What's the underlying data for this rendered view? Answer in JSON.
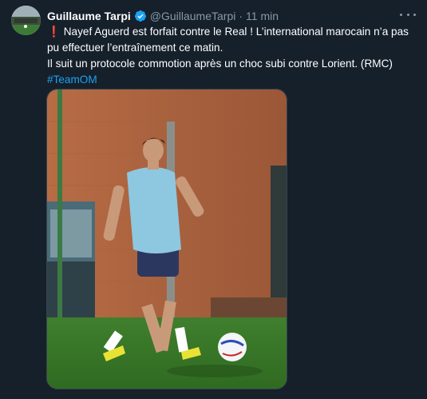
{
  "tweet": {
    "author_name": "Guillaume Tarpi",
    "author_handle": "@GuillaumeTarpi",
    "separator": "·",
    "time": "11 min",
    "line1": "Nayef Aguerd est forfait contre le Real ! L’international marocain n’a pas pu effectuer l’entraînement ce matin.",
    "line2": "Il suit un protocole commotion après un choc subi contre Lorient. (RMC)",
    "hashtag": "#TeamOM",
    "exclamation": "❗"
  },
  "colors": {
    "background": "#15202b",
    "accent": "#1da1f2",
    "secondary_text": "#8899a6"
  },
  "icons": {
    "verified": "verified-badge-icon",
    "more": "more-options-icon"
  }
}
